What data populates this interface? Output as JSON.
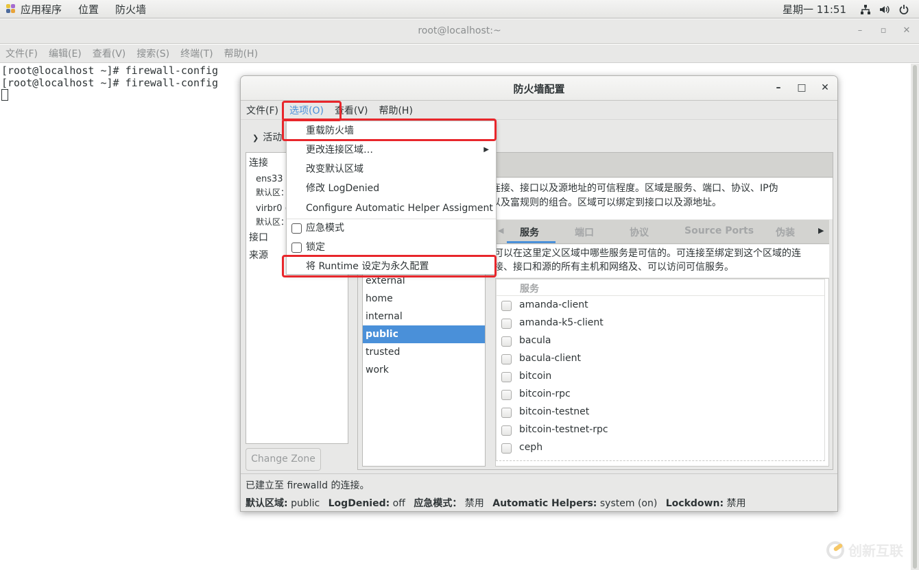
{
  "top_panel": {
    "menus": [
      "应用程序",
      "位置",
      "防火墙"
    ],
    "clock": "星期一 11:51",
    "icons": [
      "network-icon",
      "volume-icon",
      "power-icon"
    ]
  },
  "terminal": {
    "title": "root@localhost:~",
    "menus": [
      "文件(F)",
      "编辑(E)",
      "查看(V)",
      "搜索(S)",
      "终端(T)",
      "帮助(H)"
    ],
    "lines": [
      "[root@localhost ~]# firewall-config",
      "[root@localhost ~]# firewall-config"
    ]
  },
  "firewall": {
    "title": "防火墙配置",
    "menus": [
      "文件(F)",
      "选项(O)",
      "查看(V)",
      "帮助(H)"
    ],
    "active_bindings_label": "活动",
    "left_panel": {
      "connections_label": "连接",
      "connections": [
        {
          "name": "ens33 (",
          "zone": "默认区："
        },
        {
          "name": "virbr0 (",
          "zone": "默认区："
        }
      ],
      "interfaces_label": "接口",
      "sources_label": "来源",
      "change_zone_button": "Change Zone"
    },
    "zone_description": "络连接、接口以及源地址的可信程度。区域是服务、端口、协议、IP伪\n装以及富规则的组合。区域可以绑定到接口以及源地址。",
    "zones": [
      "external",
      "home",
      "internal",
      "public",
      "trusted",
      "work"
    ],
    "selected_zone": "public",
    "tabs": [
      "服务",
      "端口",
      "协议",
      "Source Ports",
      "伪装"
    ],
    "active_tab": "服务",
    "services_description": "可以在这里定义区域中哪些服务是可信的。可连接至绑定到这个区域的连\n接、接口和源的所有主机和网络及、可以访问可信服务。",
    "services_header": "服务",
    "services": [
      {
        "name": "amanda-client",
        "checked": false
      },
      {
        "name": "amanda-k5-client",
        "checked": false
      },
      {
        "name": "bacula",
        "checked": false
      },
      {
        "name": "bacula-client",
        "checked": false
      },
      {
        "name": "bitcoin",
        "checked": false
      },
      {
        "name": "bitcoin-rpc",
        "checked": false
      },
      {
        "name": "bitcoin-testnet",
        "checked": false
      },
      {
        "name": "bitcoin-testnet-rpc",
        "checked": false
      },
      {
        "name": "ceph",
        "checked": false
      }
    ],
    "status_connection": "已建立至  firewalld 的连接。",
    "status": {
      "default_zone_label": "默认区域:",
      "default_zone_value": "public",
      "log_denied_label": "LogDenied:",
      "log_denied_value": "off",
      "panic_label": "应急模式：",
      "panic_value": "禁用",
      "helpers_label": "Automatic Helpers:",
      "helpers_value": "system (on)",
      "lockdown_label": "Lockdown:",
      "lockdown_value": "禁用"
    }
  },
  "options_menu": {
    "items": [
      {
        "label": "重载防火墙",
        "type": "item"
      },
      {
        "label": "更改连接区域…",
        "type": "submenu"
      },
      {
        "label": "改变默认区域",
        "type": "item"
      },
      {
        "label": "修改  LogDenied",
        "type": "item"
      },
      {
        "label": "Configure Automatic Helper Assigment",
        "type": "item"
      },
      {
        "label": "应急模式",
        "type": "check",
        "checked": false
      },
      {
        "label": "锁定",
        "type": "check",
        "checked": false
      },
      {
        "label": "将  Runtime 设定为永久配置",
        "type": "item"
      }
    ]
  },
  "watermark": "创新互联",
  "colors": {
    "accent": "#4a90d9",
    "highlight_box": "#e8262b"
  }
}
